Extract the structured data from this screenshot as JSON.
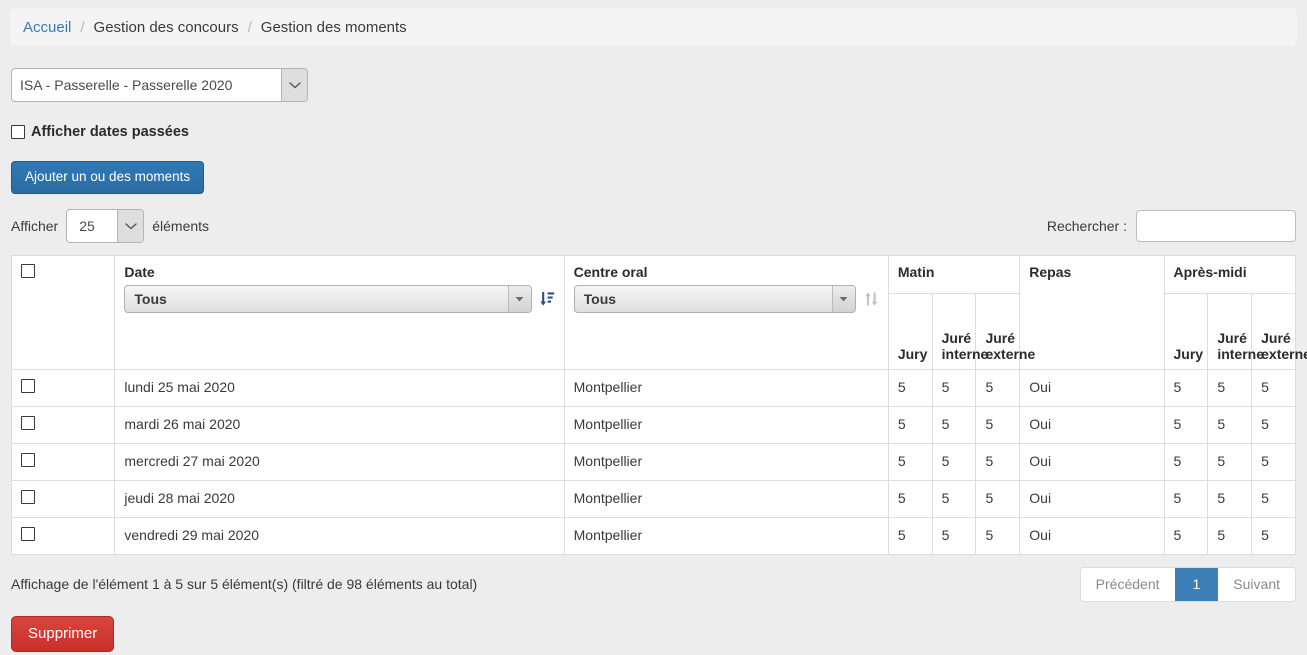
{
  "breadcrumb": {
    "separator": "/",
    "items": [
      {
        "label": "Accueil",
        "link": true
      },
      {
        "label": "Gestion des concours",
        "link": false
      },
      {
        "label": "Gestion des moments",
        "link": false
      }
    ]
  },
  "concours": {
    "selected": "ISA - Passerelle - Passerelle 2020",
    "icon": "chevron-down-icon"
  },
  "past_dates": {
    "label": "Afficher dates passées",
    "checked": false
  },
  "add_button": {
    "label": "Ajouter un ou des moments"
  },
  "table_controls": {
    "length_prefix": "Afficher",
    "length_value": "25",
    "length_suffix": "éléments",
    "search_label": "Rechercher :",
    "search_value": "",
    "search_placeholder": ""
  },
  "table": {
    "group_headers": {
      "matin": "Matin",
      "apres_midi": "Après-midi"
    },
    "columns": {
      "date": {
        "label": "Date",
        "filter_value": "Tous",
        "sort_icon": "sort-descending-icon"
      },
      "centre_oral": {
        "label": "Centre oral",
        "filter_value": "Tous",
        "sort_icon": "sort-unsorted-icon"
      },
      "matin_jury": "Jury",
      "matin_jure_interne": "Juré interne",
      "matin_jure_externe": "Juré externe",
      "repas": "Repas",
      "am_jury": "Jury",
      "am_jure_interne": "Juré interne",
      "am_jure_externe": "Juré externe"
    },
    "rows": [
      {
        "date": "lundi 25 mai 2020",
        "centre": "Montpellier",
        "m_jury": "5",
        "m_int": "5",
        "m_ext": "5",
        "repas": "Oui",
        "a_jury": "5",
        "a_int": "5",
        "a_ext": "5"
      },
      {
        "date": "mardi 26 mai 2020",
        "centre": "Montpellier",
        "m_jury": "5",
        "m_int": "5",
        "m_ext": "5",
        "repas": "Oui",
        "a_jury": "5",
        "a_int": "5",
        "a_ext": "5"
      },
      {
        "date": "mercredi 27 mai 2020",
        "centre": "Montpellier",
        "m_jury": "5",
        "m_int": "5",
        "m_ext": "5",
        "repas": "Oui",
        "a_jury": "5",
        "a_int": "5",
        "a_ext": "5"
      },
      {
        "date": "jeudi 28 mai 2020",
        "centre": "Montpellier",
        "m_jury": "5",
        "m_int": "5",
        "m_ext": "5",
        "repas": "Oui",
        "a_jury": "5",
        "a_int": "5",
        "a_ext": "5"
      },
      {
        "date": "vendredi 29 mai 2020",
        "centre": "Montpellier",
        "m_jury": "5",
        "m_int": "5",
        "m_ext": "5",
        "repas": "Oui",
        "a_jury": "5",
        "a_int": "5",
        "a_ext": "5"
      }
    ]
  },
  "footer": {
    "info": "Affichage de l'élément 1 à 5 sur 5 élément(s) (filtré de 98 éléments au total)",
    "pagination": {
      "previous": "Précédent",
      "page": "1",
      "next": "Suivant"
    },
    "delete_button": "Supprimer"
  },
  "colors": {
    "page_background": "#ededed",
    "breadcrumb_background": "#f4f4f4",
    "link": "#337ab7",
    "primary_button": "#2c6ca3",
    "danger_button": "#c9302c",
    "pagination_active": "#3c7fb7",
    "table_border": "#dddddd"
  }
}
